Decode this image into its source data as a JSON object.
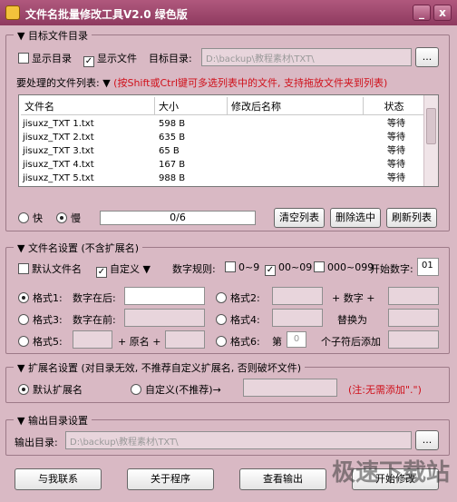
{
  "window": {
    "title": "文件名批量修改工具V2.0  绿色版",
    "min_label": "_",
    "close_label": "x"
  },
  "target_files": {
    "legend": "目标文件目录",
    "show_dirs": "显示目录",
    "show_files": "显示文件",
    "target_dir_label": "目标目录:",
    "target_dir_value": "D:\\backup\\教程素材\\TXT\\",
    "browse": "...",
    "list_label": "要处理的文件列表:",
    "list_hint": "(按Shift或Ctrl键可多选列表中的文件, 支持拖放文件夹到列表)",
    "columns": [
      "文件名",
      "大小",
      "修改后名称",
      "状态"
    ],
    "rows": [
      {
        "name": "jisuxz_TXT 1.txt",
        "size": "598 B",
        "new_name": "",
        "status": "等待"
      },
      {
        "name": "jisuxz_TXT 2.txt",
        "size": "635 B",
        "new_name": "",
        "status": "等待"
      },
      {
        "name": "jisuxz_TXT 3.txt",
        "size": "65 B",
        "new_name": "",
        "status": "等待"
      },
      {
        "name": "jisuxz_TXT 4.txt",
        "size": "167 B",
        "new_name": "",
        "status": "等待"
      },
      {
        "name": "jisuxz_TXT 5.txt",
        "size": "988 B",
        "new_name": "",
        "status": "等待"
      }
    ],
    "speed_fast": "快",
    "speed_slow": "慢",
    "progress_text": "0/6",
    "progress": 0,
    "clear_list": "清空列表",
    "delete_selected": "删除选中",
    "refresh_list": "刷新列表"
  },
  "name_settings": {
    "legend": "文件名设置 (不含扩展名)",
    "default_name": "默认文件名",
    "custom": "自定义",
    "rule_label": "数字规则:",
    "rule_0_9": "0~9",
    "rule_00_09": "00~09",
    "rule_000_099": "000~099",
    "start_label": "开始数字:",
    "start_value": "01",
    "format1": "格式1:",
    "format1_text": "数字在后:",
    "format2": "格式2:",
    "format2_plus": "+ 数字 +",
    "format3": "格式3:",
    "format3_text": "数字在前:",
    "format4": "格式4:",
    "format4_text": "替换为",
    "format5": "格式5:",
    "format5_plus1": "+ 原名 +",
    "format6": "格式6:",
    "format6_di": "第",
    "format6_num": "0",
    "format6_text": "个子符后添加"
  },
  "ext_settings": {
    "legend": "扩展名设置 (对目录无效, 不推荐自定义扩展名, 否则破坏文件)",
    "default_ext": "默认扩展名",
    "custom_ext": "自定义(不推荐)→",
    "note": "(注:无需添加\".\")"
  },
  "output_settings": {
    "legend": "输出目录设置",
    "dir_label": "输出目录:",
    "dir_value": "D:\\backup\\教程素材\\TXT\\",
    "browse": "..."
  },
  "footer": {
    "contact": "与我联系",
    "about": "关于程序",
    "view_output": "查看输出",
    "start_rename": "开始修改"
  },
  "watermark": "极速下载站",
  "colors": {
    "background": "#d9b9c4",
    "titlebar": "#9c4569",
    "hint_red": "#d0101a"
  }
}
